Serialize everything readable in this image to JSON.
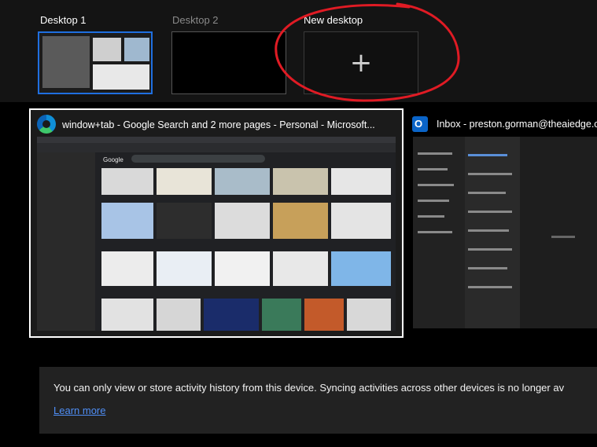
{
  "desktops": [
    {
      "label": "Desktop 1",
      "selected": true
    },
    {
      "label": "Desktop 2",
      "selected": false
    }
  ],
  "new_desktop": {
    "label": "New desktop",
    "icon": "plus-icon"
  },
  "annotation_color": "#e01b24",
  "windows": [
    {
      "title": "window+tab - Google Search and 2 more pages - Personal - Microsoft...",
      "icon": "edge-icon",
      "selected": true
    },
    {
      "title": "Inbox - preston.gorman@theaiedge.co",
      "icon": "outlook-icon",
      "selected": false
    }
  ],
  "browser": {
    "search_text": "Google"
  },
  "notice": {
    "text": "You can only view or store activity history from this device. Syncing activities across other devices is no longer av",
    "link": "Learn more"
  },
  "colors": {
    "selection": "#1f6fe0",
    "link": "#4f8ff7",
    "background": "#000000"
  }
}
